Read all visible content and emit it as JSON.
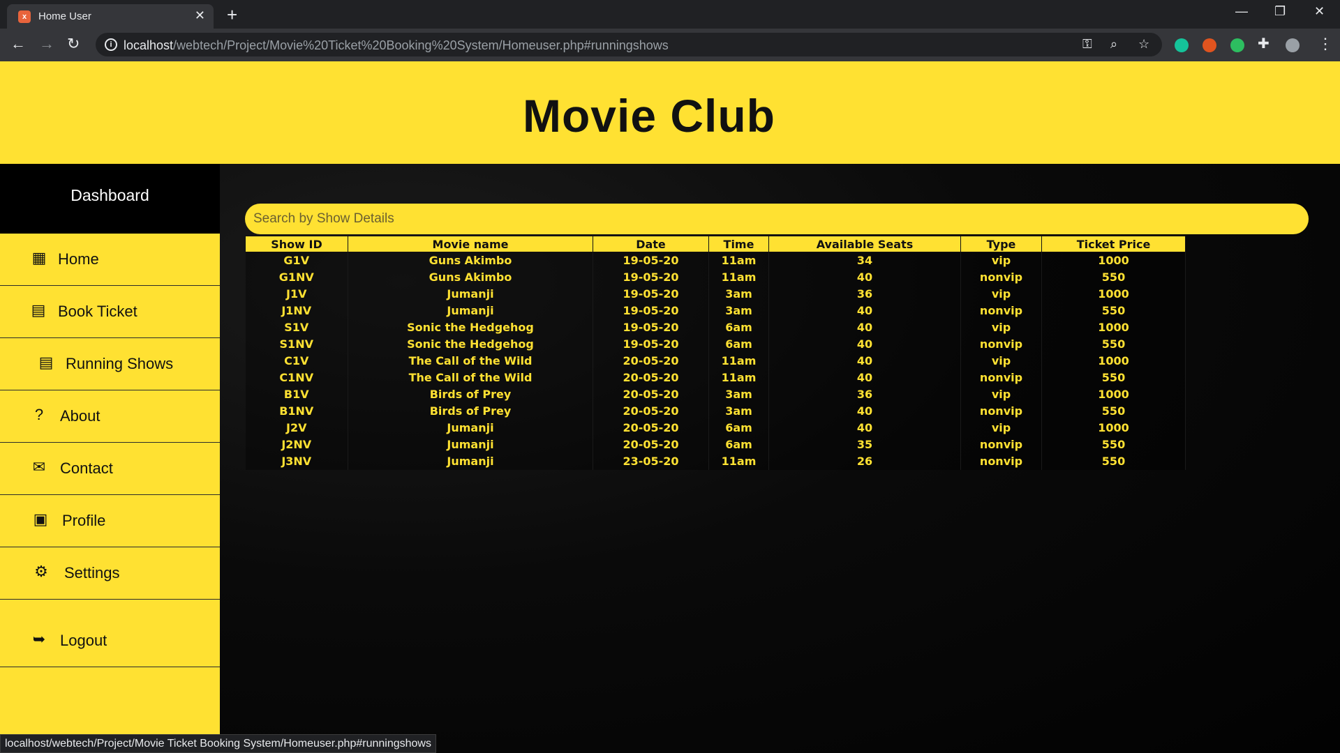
{
  "browser": {
    "tab_title": "Home User",
    "favicon_text": "x",
    "url_host": "localhost",
    "url_path": "/webtech/Project/Movie%20Ticket%20Booking%20System/Homeuser.php#runningshows",
    "status_url": "localhost/webtech/Project/Movie Ticket Booking System/Homeuser.php#runningshows"
  },
  "header": {
    "title": "Movie Club"
  },
  "sidebar": {
    "dashboard_label": "Dashboard",
    "items": [
      {
        "label": "Home",
        "icon": "grid-icon"
      },
      {
        "label": "Book Ticket",
        "icon": "calendar-icon"
      },
      {
        "label": "Running Shows",
        "icon": "calendar-icon"
      },
      {
        "label": "About",
        "icon": "question-circle-icon"
      },
      {
        "label": "Contact",
        "icon": "envelope-icon"
      },
      {
        "label": "Profile",
        "icon": "id-card-icon"
      },
      {
        "label": "Settings",
        "icon": "gears-icon"
      },
      {
        "label": "Logout",
        "icon": "sign-out-icon"
      }
    ]
  },
  "search": {
    "placeholder": "Search by Show Details",
    "value": ""
  },
  "table": {
    "columns": [
      "Show ID",
      "Movie name",
      "Date",
      "Time",
      "Available Seats",
      "Type",
      "Ticket Price"
    ],
    "rows": [
      [
        "G1V",
        "Guns Akimbo",
        "19-05-20",
        "11am",
        "34",
        "vip",
        "1000"
      ],
      [
        "G1NV",
        "Guns Akimbo",
        "19-05-20",
        "11am",
        "40",
        "nonvip",
        "550"
      ],
      [
        "J1V",
        "Jumanji",
        "19-05-20",
        "3am",
        "36",
        "vip",
        "1000"
      ],
      [
        "J1NV",
        "Jumanji",
        "19-05-20",
        "3am",
        "40",
        "nonvip",
        "550"
      ],
      [
        "S1V",
        "Sonic the Hedgehog",
        "19-05-20",
        "6am",
        "40",
        "vip",
        "1000"
      ],
      [
        "S1NV",
        "Sonic the Hedgehog",
        "19-05-20",
        "6am",
        "40",
        "nonvip",
        "550"
      ],
      [
        "C1V",
        "The Call of the Wild",
        "20-05-20",
        "11am",
        "40",
        "vip",
        "1000"
      ],
      [
        "C1NV",
        "The Call of the Wild",
        "20-05-20",
        "11am",
        "40",
        "nonvip",
        "550"
      ],
      [
        "B1V",
        "Birds of Prey",
        "20-05-20",
        "3am",
        "36",
        "vip",
        "1000"
      ],
      [
        "B1NV",
        "Birds of Prey",
        "20-05-20",
        "3am",
        "40",
        "nonvip",
        "550"
      ],
      [
        "J2V",
        "Jumanji",
        "20-05-20",
        "6am",
        "40",
        "vip",
        "1000"
      ],
      [
        "J2NV",
        "Jumanji",
        "20-05-20",
        "6am",
        "35",
        "nonvip",
        "550"
      ],
      [
        "J3NV",
        "Jumanji",
        "23-05-20",
        "11am",
        "26",
        "nonvip",
        "550"
      ]
    ]
  },
  "colors": {
    "accent": "#ffe132",
    "background": "#050505",
    "chrome_dark": "#202124",
    "chrome": "#35363a"
  }
}
